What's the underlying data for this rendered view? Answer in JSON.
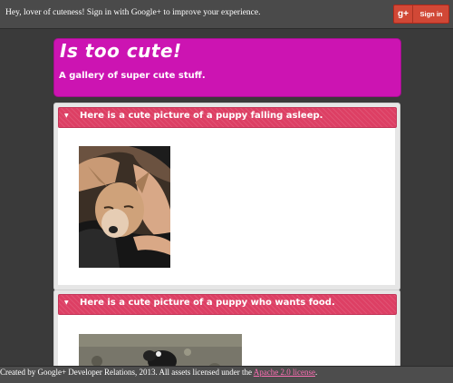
{
  "topbar": {
    "message": "Hey, lover of cuteness! Sign in with Google+ to improve your experience.",
    "signin_icon": "g+",
    "signin_label": "Sign in"
  },
  "header": {
    "title": "Is too cute!",
    "subtitle": "A gallery of super cute stuff."
  },
  "cards": [
    {
      "icon": "chevron-down-icon",
      "title": "Here is a cute picture of a puppy falling asleep."
    },
    {
      "icon": "chevron-down-icon",
      "title": "Here is a cute picture of a puppy who wants food."
    }
  ],
  "footer": {
    "text": "Created by Google+ Developer Relations, 2013. All assets licensed under the ",
    "link": "Apache 2.0 license",
    "end": "."
  },
  "colors": {
    "background": "#3a3a3a",
    "header": "#cc14b2",
    "card_header": "#dd3f64",
    "signin_button": "#d14836",
    "link": "#ff6fb5"
  }
}
